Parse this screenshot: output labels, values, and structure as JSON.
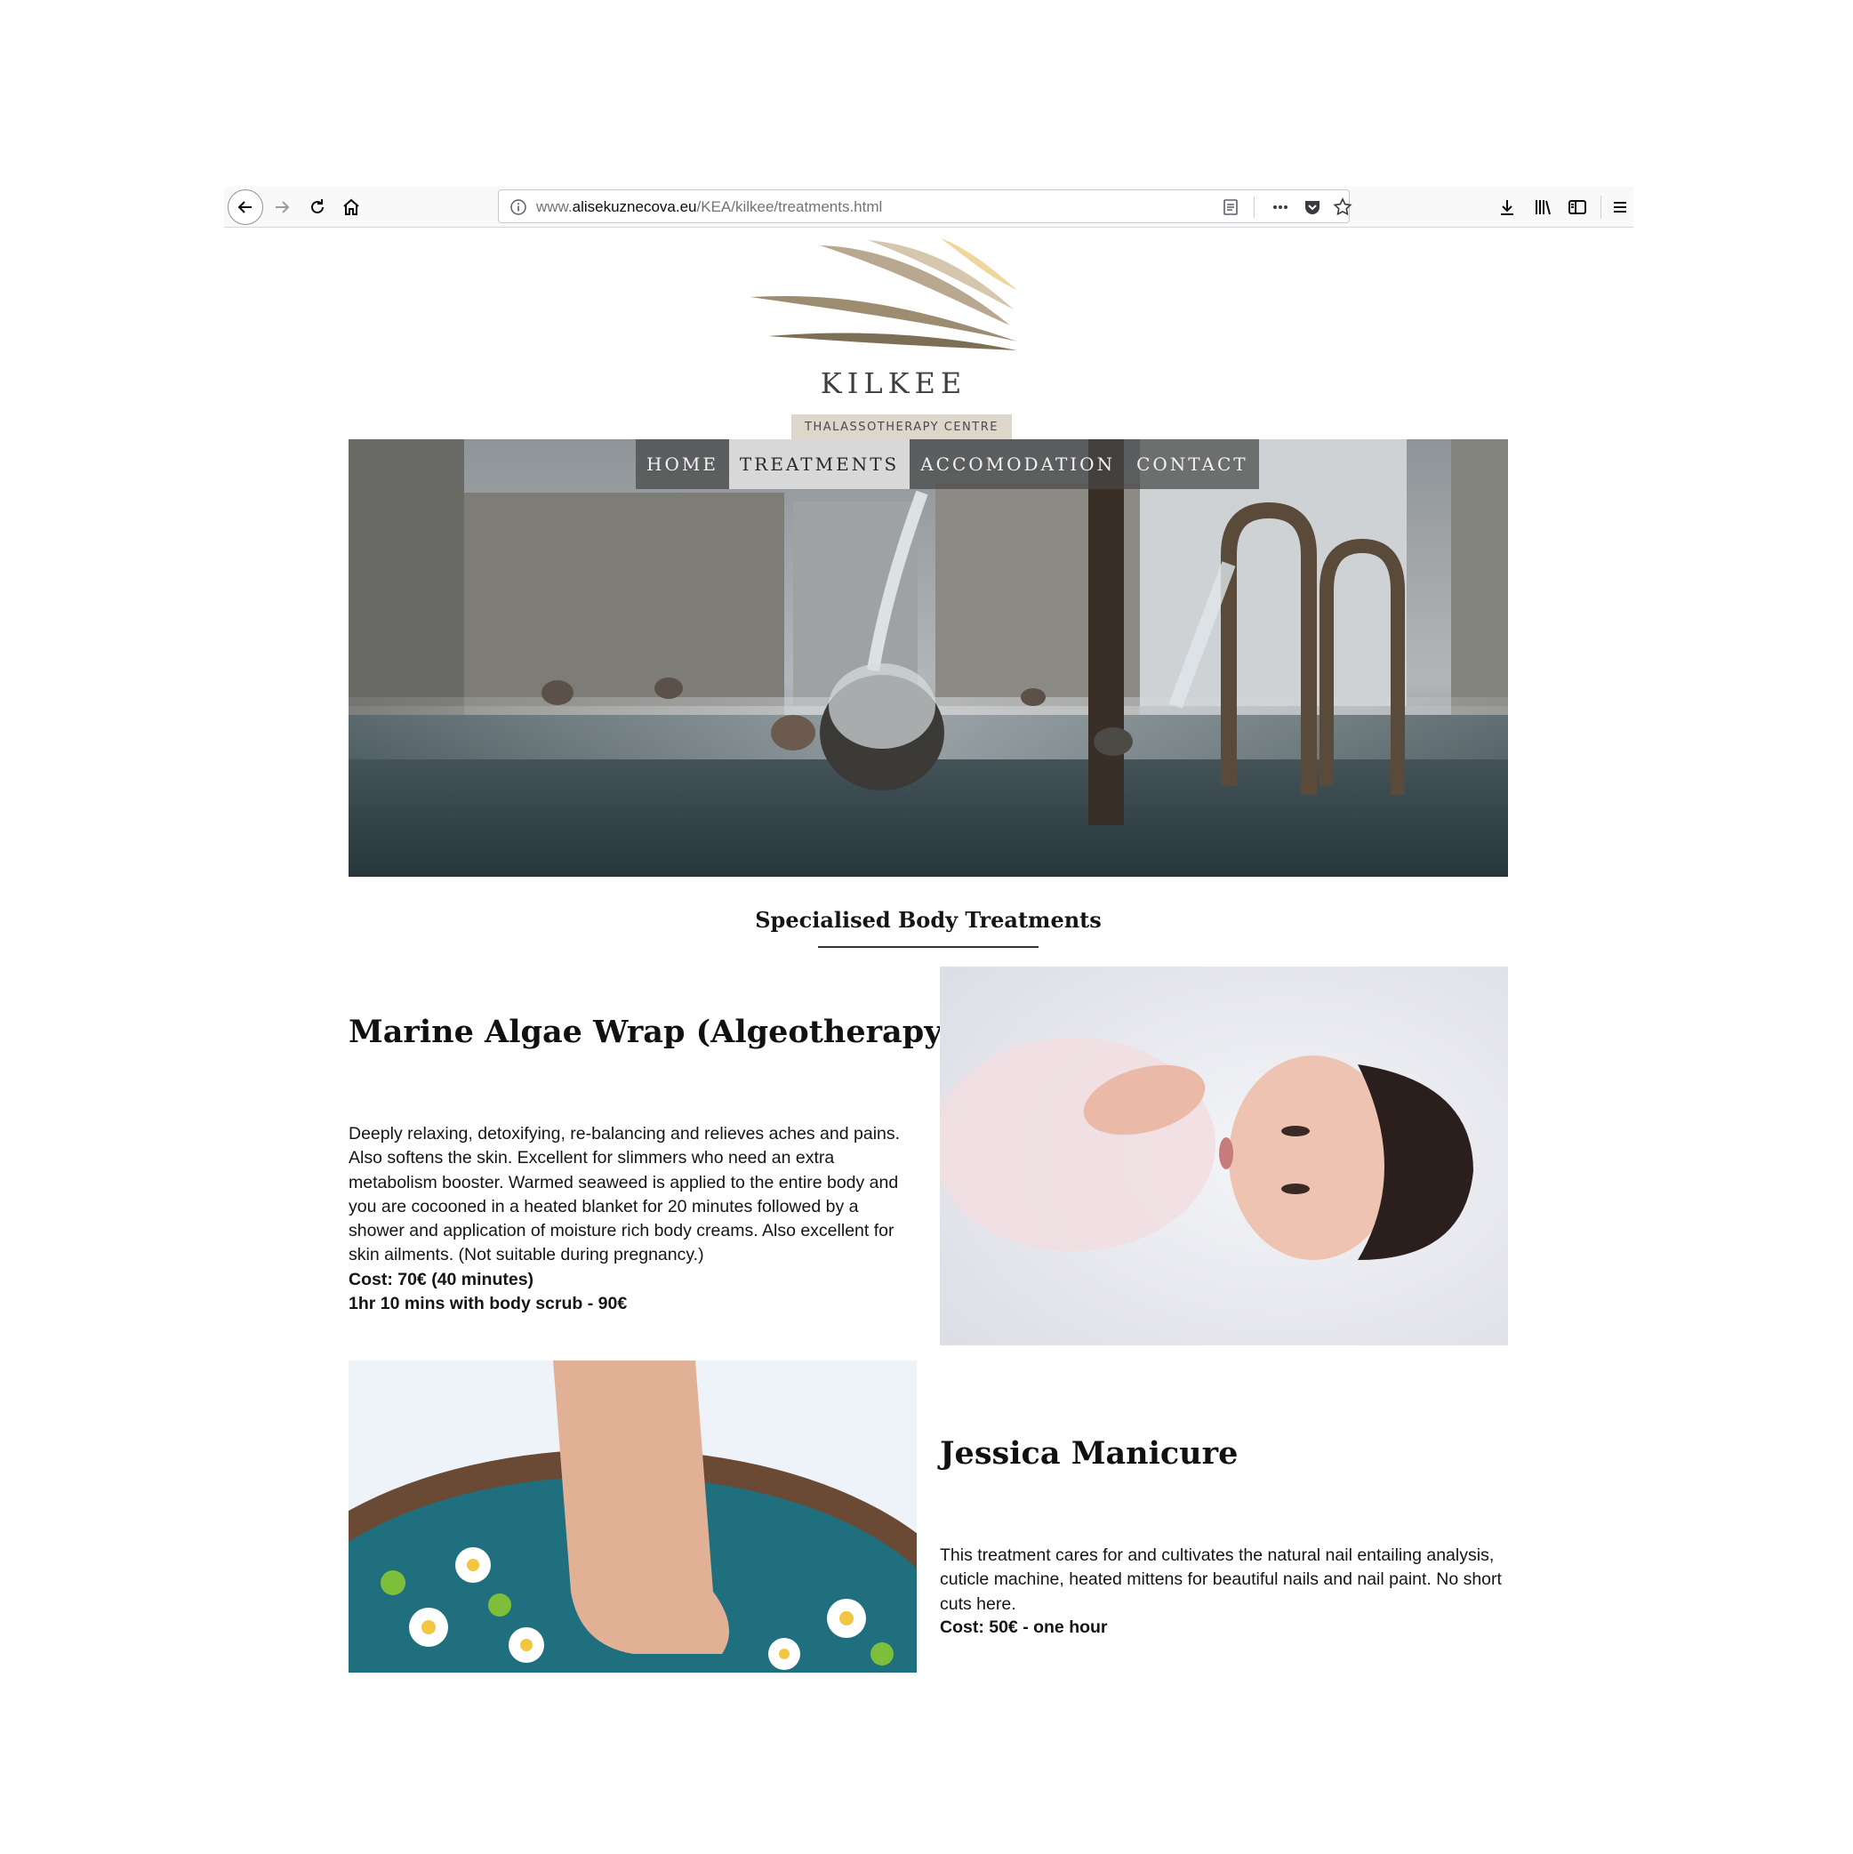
{
  "browser": {
    "url_prefix": "www.",
    "url_domain": "alisekuznecova.eu",
    "url_path": "/KEA/kilkee/treatments.html",
    "icons": [
      "back-icon",
      "forward-icon",
      "reload-icon",
      "home-icon",
      "info-icon",
      "reader-view-icon",
      "page-actions-icon",
      "pocket-icon",
      "bookmark-star-icon",
      "download-icon",
      "library-icon",
      "sidebar-icon",
      "menu-icon"
    ]
  },
  "logo": {
    "name": "KILKEE",
    "subtitle": "THALASSOTHERAPY CENTRE",
    "colors": [
      "#7a6e57",
      "#b9a88f",
      "#d9c9b0",
      "#f0d9a0"
    ]
  },
  "nav": {
    "items": [
      {
        "label": "HOME",
        "active": false
      },
      {
        "label": "TREATMENTS",
        "active": true
      },
      {
        "label": "ACCOMODATION",
        "active": false
      },
      {
        "label": "CONTACT",
        "active": false
      }
    ]
  },
  "main": {
    "section_title": "Specialised Body Treatments",
    "treatments": [
      {
        "title": "Marine Algae Wrap (Algeotherapy)",
        "description": "Deeply relaxing, detoxifying, re-balancing and relieves aches and pains. Also softens the skin. Excellent for slimmers who need an extra metabolism booster. Warmed seaweed is applied to the entire body and you are cocooned in a heated blanket for 20 minutes followed by a shower and application of moisture rich body creams. Also excellent for skin ailments. (Not suitable during pregnancy.)",
        "cost_lines": [
          "Cost: 70€ (40 minutes)",
          "1hr 10 mins with body scrub - 90€"
        ]
      },
      {
        "title": "Jessica Manicure",
        "description": "This treatment cares for and cultivates the natural nail entailing analysis, cuticle machine, heated mittens for beautiful nails and nail paint. No short cuts here.",
        "cost_lines": [
          "Cost: 50€ - one hour"
        ]
      }
    ]
  }
}
